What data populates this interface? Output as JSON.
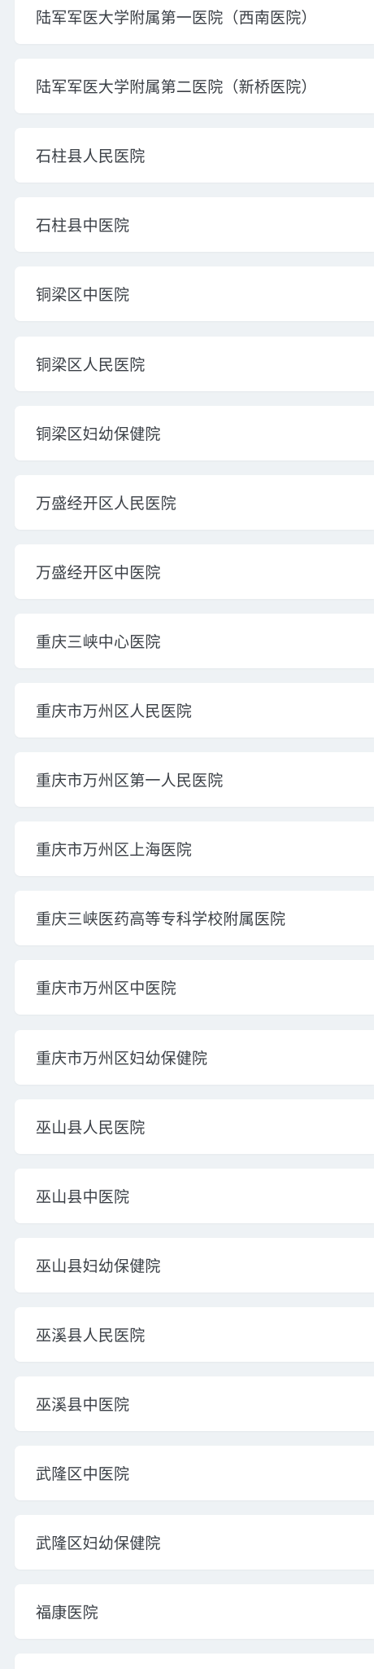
{
  "hospitals": [
    "陆军军医大学附属第一医院（西南医院）",
    "陆军军医大学附属第二医院（新桥医院）",
    "石柱县人民医院",
    "石柱县中医院",
    "铜梁区中医院",
    "铜梁区人民医院",
    "铜梁区妇幼保健院",
    "万盛经开区人民医院",
    "万盛经开区中医院",
    "重庆三峡中心医院",
    "重庆市万州区人民医院",
    "重庆市万州区第一人民医院",
    "重庆市万州区上海医院",
    "重庆三峡医药高等专科学校附属医院",
    "重庆市万州区中医院",
    "重庆市万州区妇幼保健院",
    "巫山县人民医院",
    "巫山县中医院",
    "巫山县妇幼保健院",
    "巫溪县人民医院",
    "巫溪县中医院",
    "武隆区中医院",
    "武隆区妇幼保健院",
    "福康医院",
    ""
  ]
}
